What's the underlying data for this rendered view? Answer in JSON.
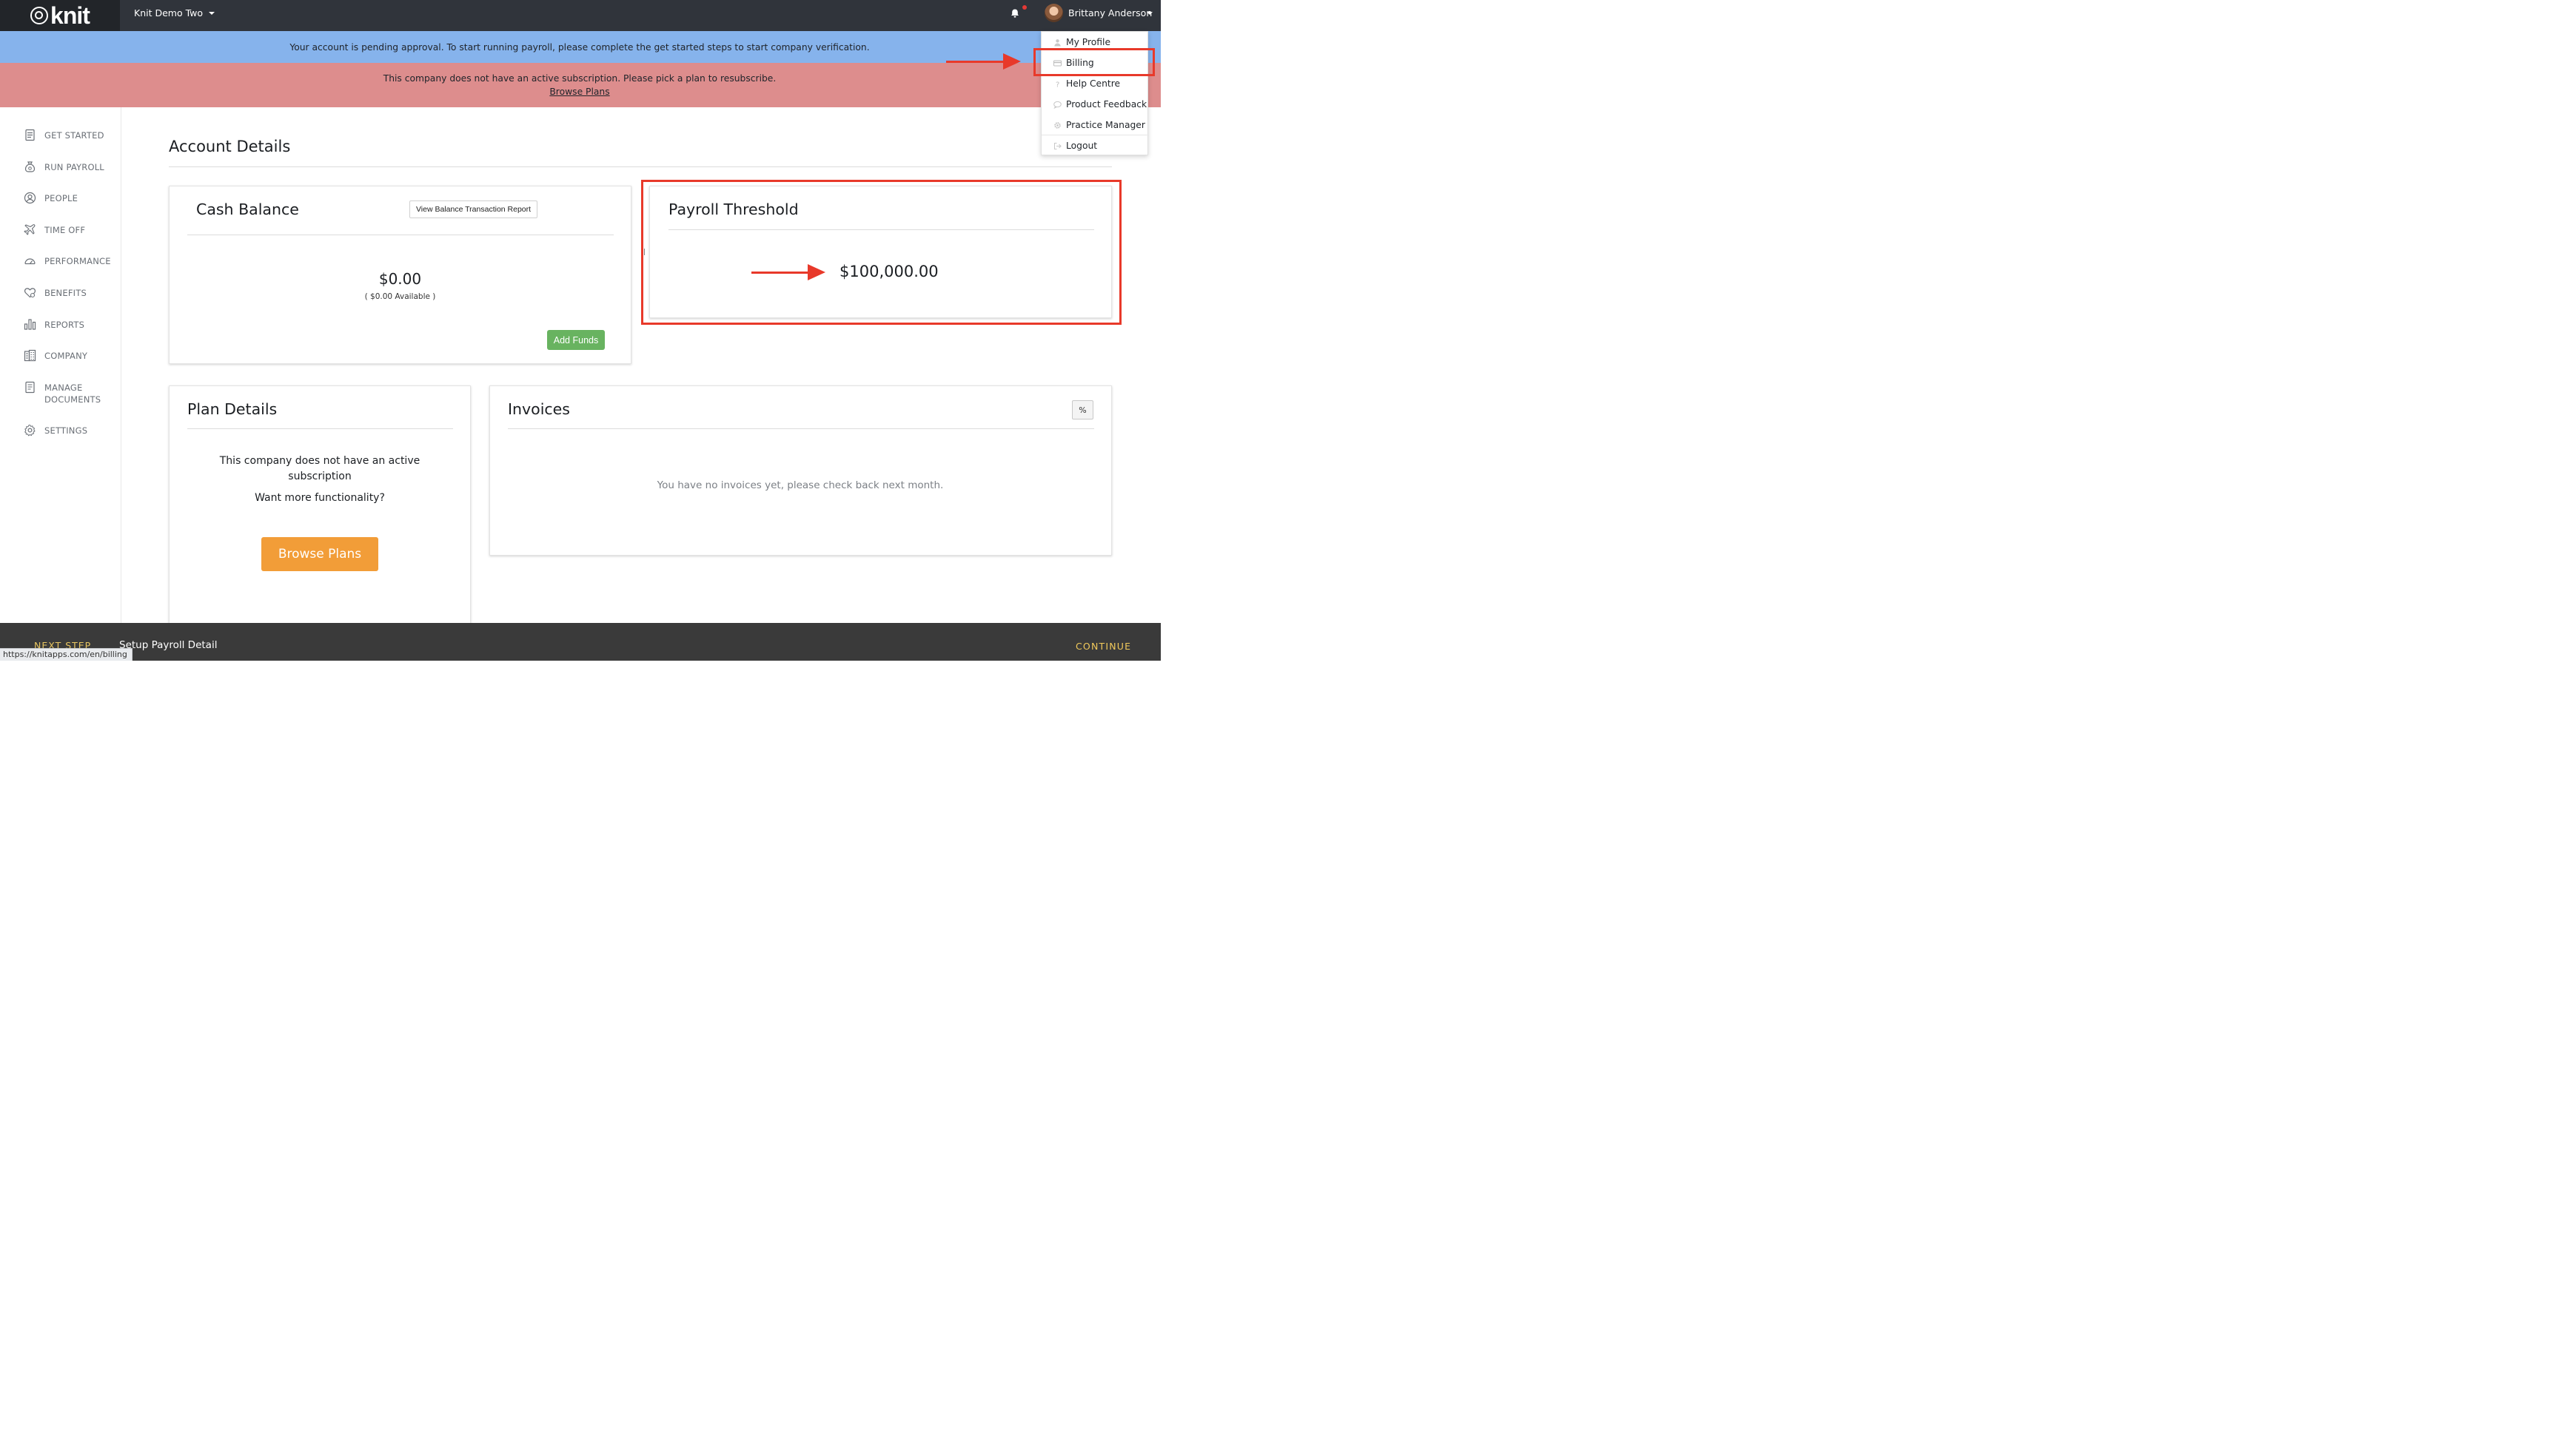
{
  "header": {
    "logo_text": "knit",
    "company_name": "Knit Demo Two",
    "user_name": "Brittany Anderson"
  },
  "banners": {
    "pending": "Your account is pending approval. To start running payroll, please complete the get started steps to start company verification.",
    "subscription": "This company does not have an active subscription. Please pick a plan to resubscribe.",
    "subscription_link": "Browse Plans"
  },
  "sidebar": {
    "items": [
      {
        "label": "GET STARTED",
        "icon": "checklist-icon"
      },
      {
        "label": "RUN PAYROLL",
        "icon": "money-bag-icon"
      },
      {
        "label": "PEOPLE",
        "icon": "person-icon"
      },
      {
        "label": "TIME OFF",
        "icon": "airplane-icon"
      },
      {
        "label": "PERFORMANCE",
        "icon": "gauge-icon"
      },
      {
        "label": "BENEFITS",
        "icon": "heart-icon"
      },
      {
        "label": "REPORTS",
        "icon": "bar-chart-icon"
      },
      {
        "label": "COMPANY",
        "icon": "building-icon"
      },
      {
        "label": "MANAGE",
        "label2": "DOCUMENTS",
        "icon": "document-icon"
      },
      {
        "label": "SETTINGS",
        "icon": "gear-icon"
      }
    ]
  },
  "main": {
    "title": "Account Details",
    "cash": {
      "title": "Cash Balance",
      "report_button": "View Balance Transaction Report",
      "amount": "$0.00",
      "available": "( $0.00 Available )",
      "add_funds": "Add Funds"
    },
    "threshold": {
      "title": "Payroll Threshold",
      "amount": "$100,000.00"
    },
    "plan": {
      "title": "Plan Details",
      "line1": "This company does not have an active",
      "line2": "subscription",
      "line3": "Want more functionality?",
      "button": "Browse Plans"
    },
    "invoices": {
      "title": "Invoices",
      "filter_glyph": "%",
      "empty": "You have no invoices yet, please check back next month."
    }
  },
  "dropdown": {
    "items": [
      "My Profile",
      "Billing",
      "Help Centre",
      "Product Feedback",
      "Practice Manager",
      "Logout"
    ]
  },
  "footer": {
    "next_step_label": "NEXT STEP",
    "next_step_title": "Setup Payroll Detail",
    "continue": "CONTINUE"
  },
  "status_url": "https://knitapps.com/en/billing",
  "colors": {
    "annotation": "#e8392a",
    "banner_info": "#86b3ec",
    "banner_alert": "#dd8d8d",
    "primary_green": "#68b360",
    "primary_orange": "#f29d38"
  }
}
